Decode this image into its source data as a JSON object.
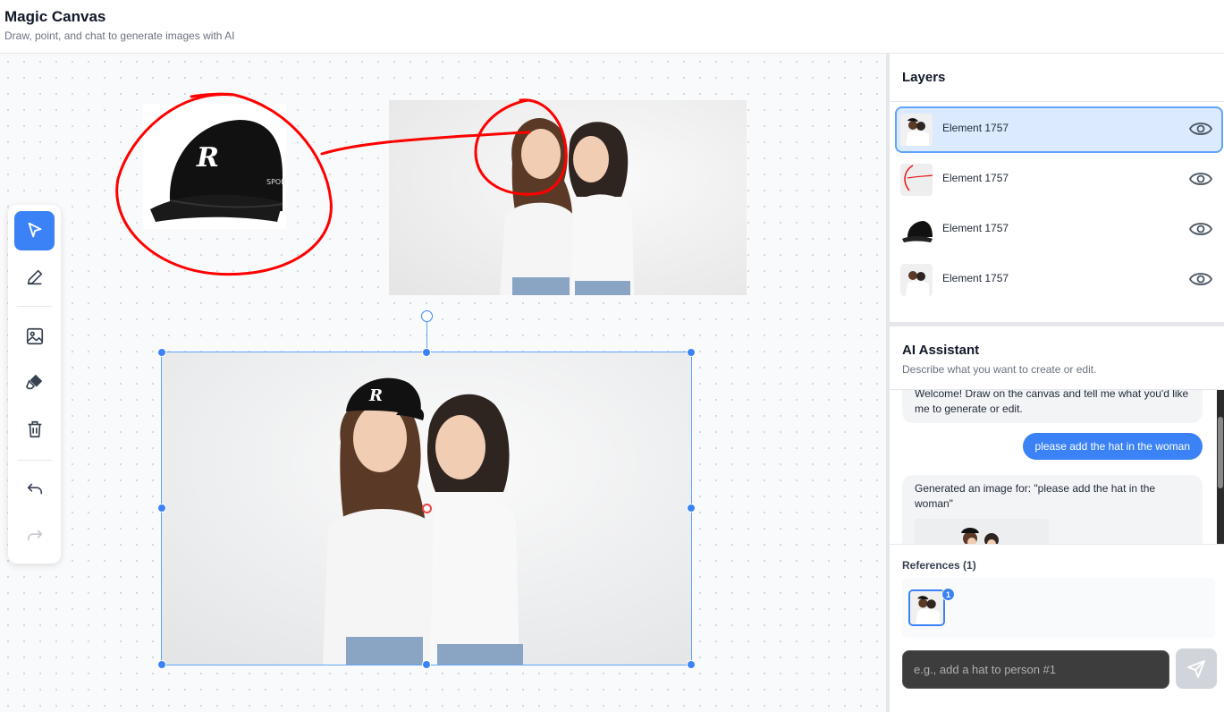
{
  "header": {
    "title": "Magic Canvas",
    "subtitle": "Draw, point, and chat to generate images with AI"
  },
  "toolbar": {
    "tools": [
      "select-tool",
      "pen-tool",
      "image-tool",
      "eraser-tool",
      "delete-tool",
      "undo-tool",
      "redo-tool"
    ],
    "active_tool": "select-tool",
    "accent_color": "#3b82f6"
  },
  "canvas": {
    "annotation_color": "#ff0000",
    "cap_logo_text": "R",
    "cap_side_text": "SPORT"
  },
  "layers": {
    "title": "Layers",
    "items": [
      {
        "name": "Element 1757",
        "thumb": "women-with-hat",
        "selected": true
      },
      {
        "name": "Element 1757",
        "thumb": "drawing-stroke",
        "selected": false
      },
      {
        "name": "Element 1757",
        "thumb": "cap",
        "selected": false
      },
      {
        "name": "Element 1757",
        "thumb": "women",
        "selected": false
      }
    ]
  },
  "assistant": {
    "title": "AI Assistant",
    "subtitle": "Describe what you want to create or edit.",
    "messages": {
      "welcome": "Welcome! Draw on the canvas and tell me what you'd like me to generate or edit.",
      "user": "please add the hat in the woman",
      "generated": "Generated an image for: \"please add the hat in the woman\""
    },
    "references_label": "References (1)",
    "reference_badge": "1",
    "input_placeholder": "e.g., add a hat to person #1"
  }
}
